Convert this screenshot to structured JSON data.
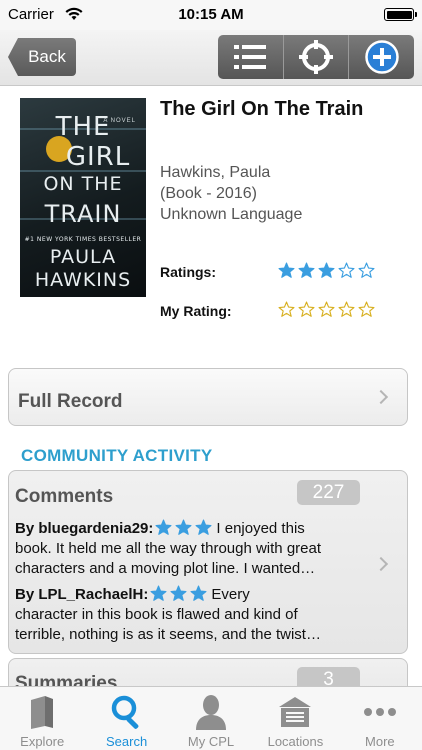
{
  "status": {
    "carrier": "Carrier",
    "time": "10:15 AM"
  },
  "nav": {
    "back_label": "Back",
    "tools": [
      "list-icon",
      "locate-icon",
      "add-icon"
    ]
  },
  "book": {
    "cover_lines": [
      "THE",
      "GIRL",
      "ON THE",
      "TRAIN"
    ],
    "cover_author_lines": [
      "PAULA",
      "HAWKINS"
    ],
    "cover_novel": "A NOVEL",
    "cover_bestseller": "#1 NEW YORK TIMES BESTSELLER",
    "title": "The Girl On The Train",
    "author": "Hawkins, Paula",
    "format": "(Book - 2016)",
    "language": "Unknown Language",
    "ratings_label": "Ratings:",
    "ratings_value": 3,
    "my_rating_label": "My Rating:",
    "my_rating_value": 0,
    "max_rating": 5
  },
  "full_record": {
    "label": "Full Record"
  },
  "community": {
    "title": "COMMUNITY ACTIVITY",
    "comments_label": "Comments",
    "comments_count": "227",
    "comments": [
      {
        "author": "By bluegardenia29:",
        "stars": 3,
        "lines": [
          "I enjoyed this",
          "book. It held me all the way through with great",
          "characters and a moving plot line. I wanted…"
        ]
      },
      {
        "author": "By LPL_RachaelH:",
        "stars": 3,
        "lines": [
          "Every",
          "character in this book is flawed and kind of",
          "terrible, nothing is as it seems, and the twist…"
        ]
      }
    ],
    "summaries_label": "Summaries",
    "summaries_count": "3"
  },
  "tabs": [
    {
      "label": "Explore",
      "icon": "book-icon",
      "active": false
    },
    {
      "label": "Search",
      "icon": "search-icon",
      "active": true
    },
    {
      "label": "My CPL",
      "icon": "person-icon",
      "active": false
    },
    {
      "label": "Locations",
      "icon": "building-icon",
      "active": false
    },
    {
      "label": "More",
      "icon": "more-icon",
      "active": false
    }
  ],
  "colors": {
    "accent": "#2e9fcd",
    "active_tab": "#1a8fd8",
    "star_blue": "#3a9ee0",
    "star_gold": "#d8b020"
  }
}
